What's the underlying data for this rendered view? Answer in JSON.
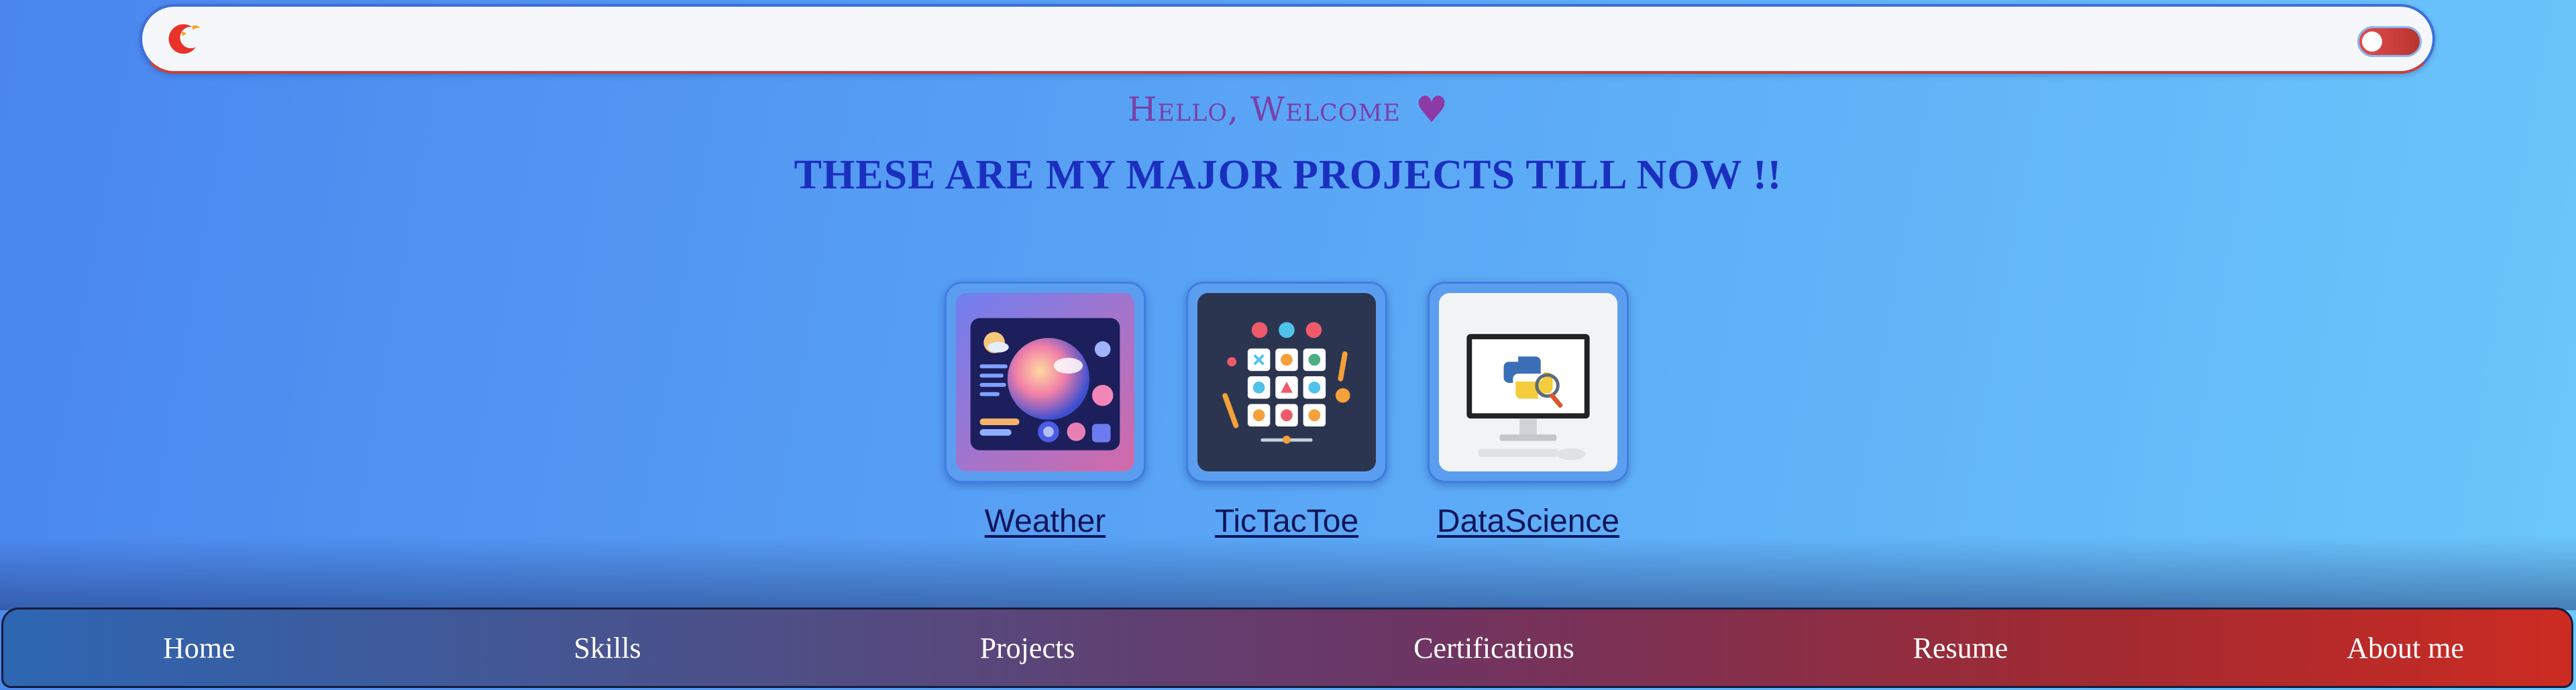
{
  "topbar": {
    "logo_icon": "red-crescent-logo-icon",
    "toggle_icon": "theme-toggle-icon",
    "colors": {
      "border_top": "#3c6fd8",
      "border_bottom": "#c8413a",
      "toggle": "#e24c4c"
    }
  },
  "greeting": {
    "text": "Hello, Welcome",
    "icon": "heart-icon",
    "heart_glyph": "♥"
  },
  "headline": "These are my major projects till now !!",
  "projects": [
    {
      "label": "Weather",
      "image": "weather-dashboard-thumbnail"
    },
    {
      "label": "TicTacToe",
      "image": "tictactoe-grid-thumbnail"
    },
    {
      "label": "DataScience",
      "image": "python-monitor-thumbnail"
    }
  ],
  "nav": {
    "items": [
      "Home",
      "Skills",
      "Projects",
      "Certifications",
      "Resume",
      "About me"
    ]
  },
  "colors": {
    "background_start": "#4a86ee",
    "background_end": "#6bc7fb",
    "greeting": "#7a3fa8",
    "headline": "#1b2fbf",
    "nav_start": "#2d66b2",
    "nav_end": "#cc2b22"
  }
}
